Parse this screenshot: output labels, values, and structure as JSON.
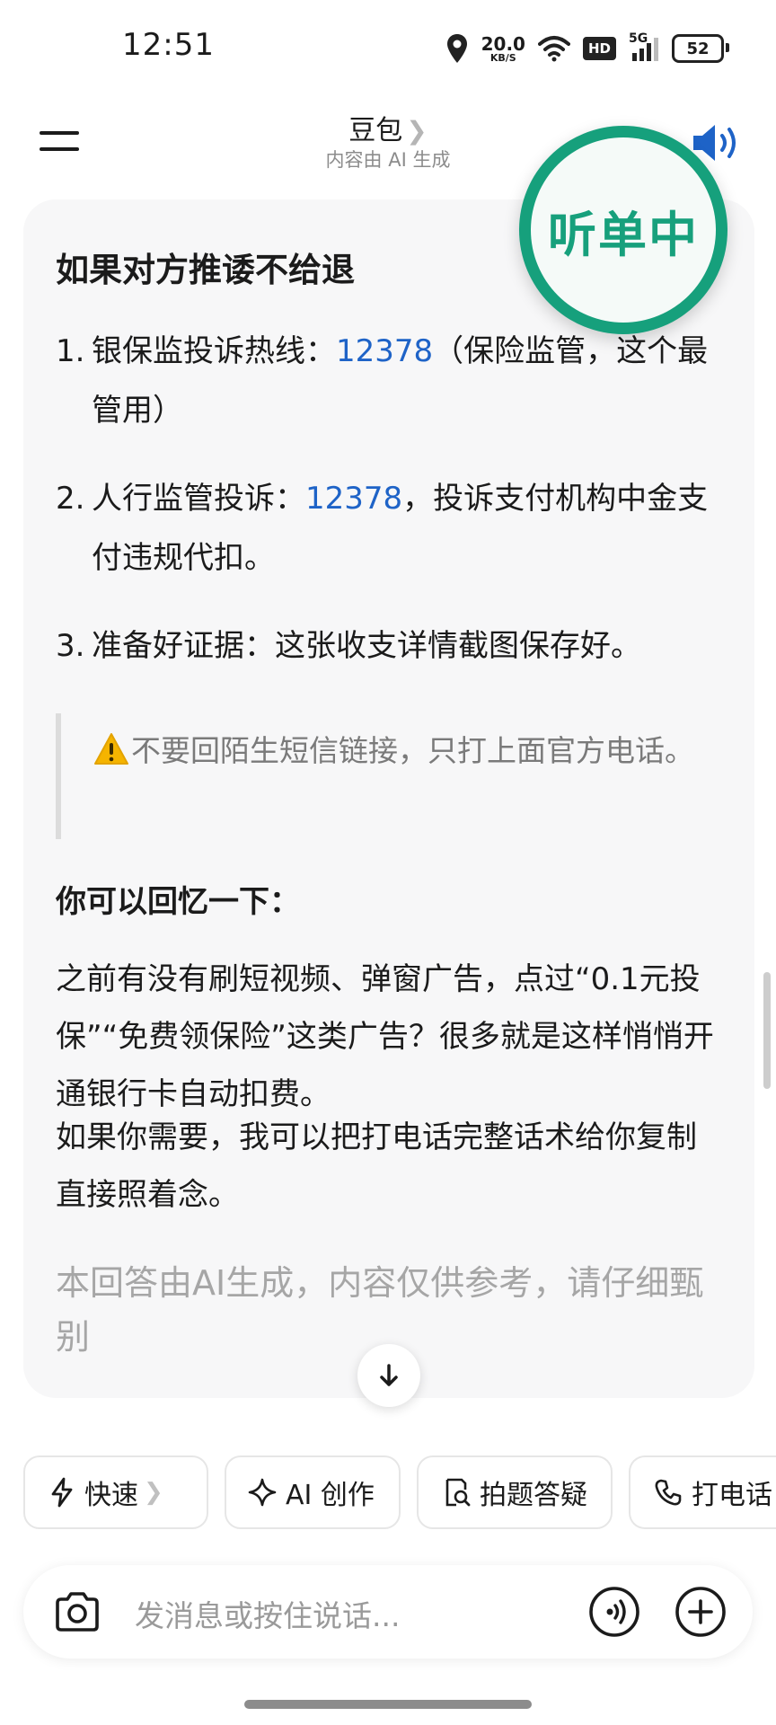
{
  "status_bar": {
    "time": "12:51",
    "net_speed_value": "20.0",
    "net_speed_unit": "KB/S",
    "hd_label": "HD",
    "signal_label": "5G",
    "battery": "52"
  },
  "header": {
    "title": "豆包",
    "subtitle": "内容由 AI 生成"
  },
  "listening_badge": "听单中",
  "message": {
    "section_title": "如果对方推诿不给退",
    "items": [
      {
        "num": "1.",
        "pre": "银保监投诉热线：",
        "link": "12378",
        "post": "（保险监管，这个最管用）"
      },
      {
        "num": "2.",
        "pre": "人行监管投诉：",
        "link": "12378",
        "post": "，投诉支付机构中金支付违规代扣。"
      },
      {
        "num": "3.",
        "pre": "准备好证据：这张收支详情截图保存好。",
        "link": "",
        "post": ""
      }
    ],
    "quote": "不要回陌生短信链接，只打上面官方电话。",
    "subheading": "你可以回忆一下：",
    "paragraph1": "之前有没有刷短视频、弹窗广告，点过“0.1元投保”“免费领保险”这类广告？很多就是这样悄悄开通银行卡自动扣费。",
    "paragraph2": "如果你需要，我可以把打电话完整话术给你复制直接照着念。",
    "disclaimer": "本回答由AI生成，内容仅供参考，请仔细甄别"
  },
  "chips": [
    {
      "label": "快速",
      "icon": "lightning-icon"
    },
    {
      "label": "AI 创作",
      "icon": "sparkle-icon"
    },
    {
      "label": "拍题答疑",
      "icon": "photo-search-icon"
    },
    {
      "label": "打电话",
      "icon": "phone-icon"
    }
  ],
  "input": {
    "placeholder": "发消息或按住说话..."
  },
  "colors": {
    "accent_blue": "#1e63c7",
    "listening_green": "#16a07c"
  }
}
